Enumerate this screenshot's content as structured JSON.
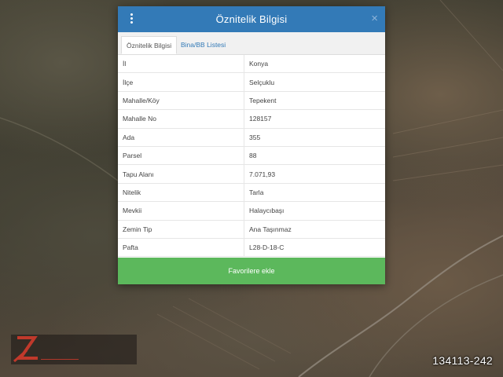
{
  "dialog": {
    "title": "Öznitelik Bilgisi",
    "close_glyph": "×",
    "header_color": "#337ab7",
    "icons": {
      "menu": "vertical-dots-icon",
      "close": "close-icon"
    }
  },
  "tabs": [
    {
      "label": "Öznitelik Bilgisi",
      "active": true
    },
    {
      "label": "Bina/BB Listesi",
      "active": false
    }
  ],
  "attributes": [
    {
      "key": "İl",
      "value": "Konya"
    },
    {
      "key": "İlçe",
      "value": "Selçuklu"
    },
    {
      "key": "Mahalle/Köy",
      "value": "Tepekent"
    },
    {
      "key": "Mahalle No",
      "value": "128157"
    },
    {
      "key": "Ada",
      "value": "355"
    },
    {
      "key": "Parsel",
      "value": "88"
    },
    {
      "key": "Tapu Alanı",
      "value": "7.071,93"
    },
    {
      "key": "Nitelik",
      "value": "Tarla"
    },
    {
      "key": "Mevkii",
      "value": "Halaycıbaşı"
    },
    {
      "key": "Zemin Tip",
      "value": "Ana Taşınmaz"
    },
    {
      "key": "Pafta",
      "value": "L28-D-18-C"
    }
  ],
  "favorite_button": {
    "label": "Favorilere ekle",
    "color": "#5cb85c"
  },
  "watermark": {
    "listing_id": "134113-242"
  }
}
